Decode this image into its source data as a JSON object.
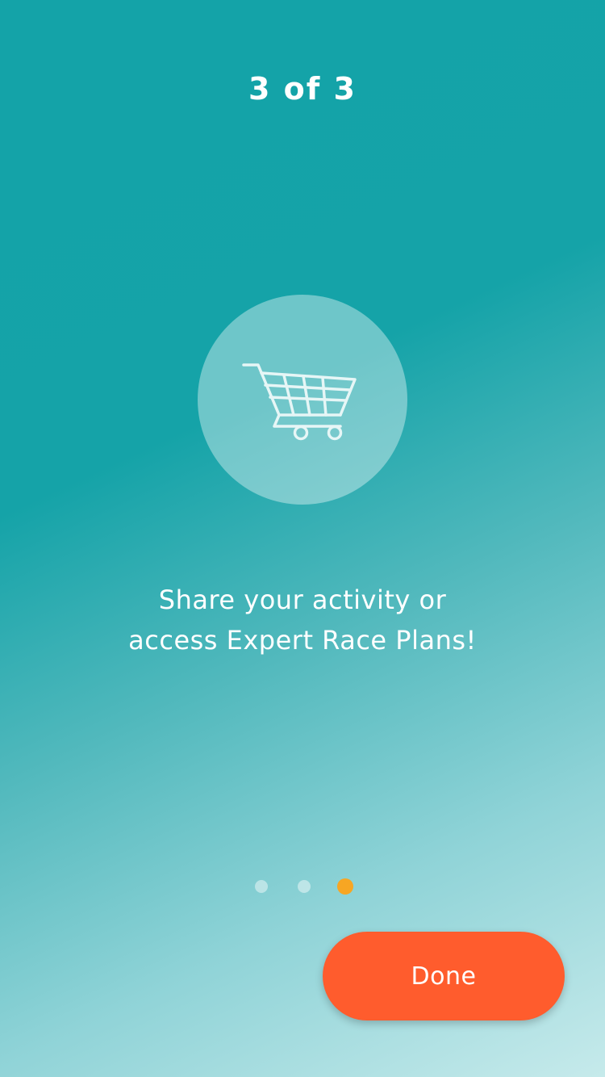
{
  "header": {
    "step_text": "3 of 3"
  },
  "illustration": {
    "icon": "shopping-cart-icon"
  },
  "message": {
    "line1": "Share your activity or",
    "line2": "access Expert Race Plans!"
  },
  "pager": {
    "total": 3,
    "active_index": 2,
    "active_color": "#f7a623"
  },
  "actions": {
    "done_label": "Done"
  },
  "colors": {
    "background_top": "#14a3a8",
    "background_bottom": "#c6eaeb",
    "button": "#ff5c2d"
  }
}
